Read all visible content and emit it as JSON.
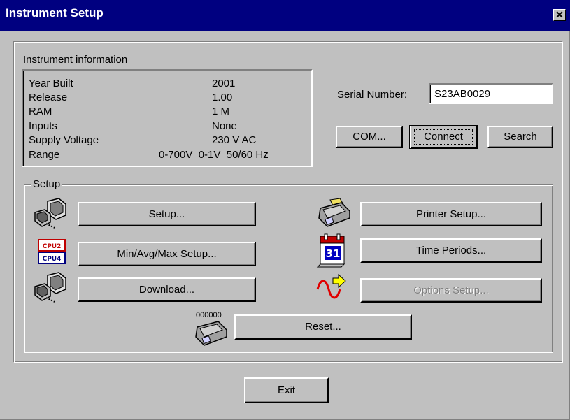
{
  "window": {
    "title": "Instrument Setup",
    "close_symbol": "✕"
  },
  "instrument_info": {
    "heading": "Instrument information",
    "rows": [
      {
        "key": "Year Built",
        "value": "2001"
      },
      {
        "key": "Release",
        "value": "1.00"
      },
      {
        "key": "RAM",
        "value": "1 M"
      },
      {
        "key": "Inputs",
        "value": "None"
      },
      {
        "key": "Supply Voltage",
        "value": "230 V AC"
      },
      {
        "key": "Range",
        "value": "0-700V  0-1V  50/60 Hz"
      }
    ]
  },
  "serial": {
    "label": "Serial Number:",
    "value": "S23AB0029"
  },
  "connection_buttons": {
    "com": "COM...",
    "connect": "Connect",
    "search": "Search"
  },
  "setup": {
    "legend": "Setup",
    "setup_button": "Setup...",
    "minavgmax_button": "Min/Avg/Max Setup...",
    "download_button": "Download...",
    "printer_button": "Printer Setup...",
    "time_periods_button": "Time Periods...",
    "options_button": "Options Setup...",
    "reset_button": "Reset...",
    "reset_counter": "000000",
    "cpu_label_1": "CPU2",
    "cpu_label_2": "CPU4",
    "calendar_day": "31"
  },
  "exit_button": "Exit",
  "colors": {
    "titlebar": "#000080",
    "face": "#c0c0c0",
    "shadow": "#808080",
    "disabled": "#808080"
  },
  "icons": [
    "close-icon",
    "computer-transfer-icon",
    "cpu-chip-icon",
    "printer-icon",
    "calendar-icon",
    "signal-arrow-icon",
    "reset-counter-icon"
  ]
}
